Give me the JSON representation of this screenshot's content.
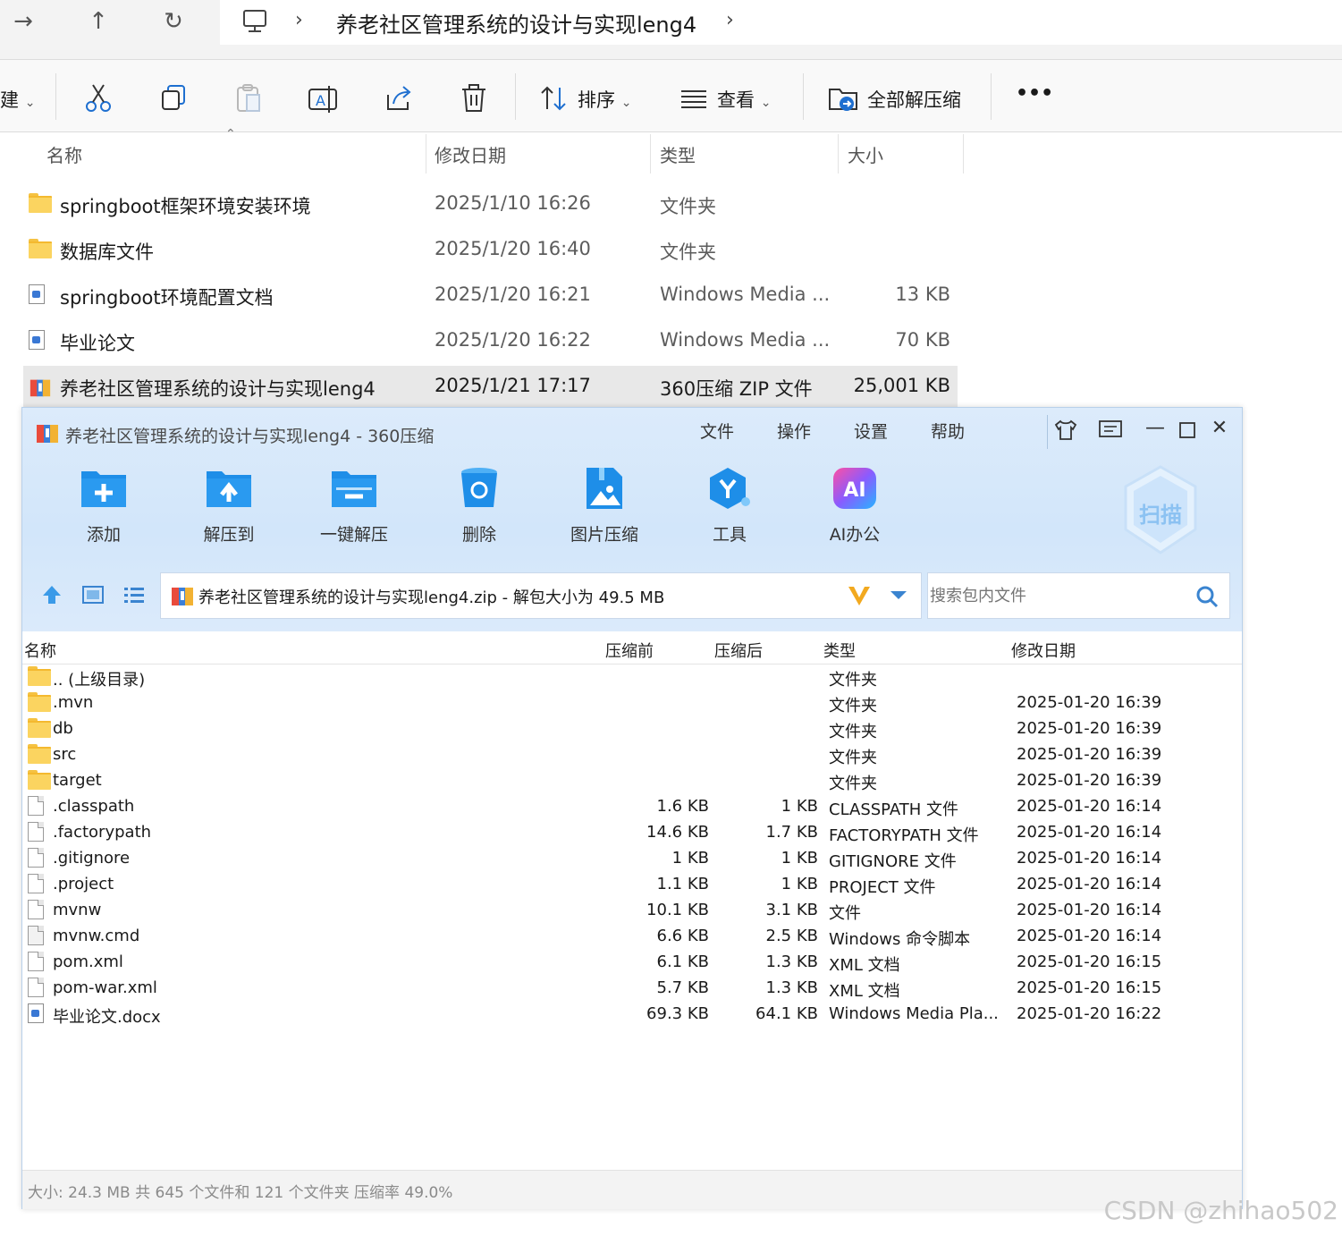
{
  "explorer": {
    "address": {
      "path": "养老社区管理系统的设计与实现leng4"
    },
    "commands": {
      "new_partial": "建",
      "sort": "排序",
      "view": "查看",
      "extract_all": "全部解压缩",
      "more": "•••"
    },
    "columns": {
      "name": "名称",
      "modified": "修改日期",
      "type": "类型",
      "size": "大小"
    },
    "files": [
      {
        "name": "springboot框架环境安装环境",
        "modified": "2025/1/10 16:26",
        "type": "文件夹",
        "size": "",
        "icon": "folder-icon"
      },
      {
        "name": "数据库文件",
        "modified": "2025/1/20 16:40",
        "type": "文件夹",
        "size": "",
        "icon": "folder-icon"
      },
      {
        "name": "springboot环境配置文档",
        "modified": "2025/1/20 16:21",
        "type": "Windows Media ...",
        "size": "13 KB",
        "icon": "media-file-icon"
      },
      {
        "name": "毕业论文",
        "modified": "2025/1/20 16:22",
        "type": "Windows Media ...",
        "size": "70 KB",
        "icon": "media-file-icon"
      },
      {
        "name": "养老社区管理系统的设计与实现leng4",
        "modified": "2025/1/21 17:17",
        "type": "360压缩 ZIP 文件",
        "size": "25,001 KB",
        "icon": "zip-archive-icon"
      }
    ]
  },
  "zip_window": {
    "title": "养老社区管理系统的设计与实现leng4 - 360压缩",
    "menu": [
      "文件",
      "操作",
      "设置",
      "帮助"
    ],
    "toolbar": [
      {
        "label": "添加",
        "icon": "add-icon"
      },
      {
        "label": "解压到",
        "icon": "extract-to-icon"
      },
      {
        "label": "一键解压",
        "icon": "one-click-extract-icon"
      },
      {
        "label": "删除",
        "icon": "delete-icon"
      },
      {
        "label": "图片压缩",
        "icon": "image-compress-icon"
      },
      {
        "label": "工具",
        "icon": "tools-icon"
      },
      {
        "label": "AI办公",
        "icon": "ai-office-icon"
      }
    ],
    "ai_badge": "AI",
    "scan_badge": "扫描",
    "address": "养老社区管理系统的设计与实现leng4.zip - 解包大小为 49.5 MB",
    "search_placeholder": "搜索包内文件",
    "columns": {
      "name": "名称",
      "before": "压缩前",
      "after": "压缩后",
      "type": "类型",
      "modified": "修改日期"
    },
    "files": [
      {
        "name": ".. (上级目录)",
        "before": "",
        "after": "",
        "type": "文件夹",
        "modified": "",
        "icon": "folder-icon"
      },
      {
        "name": ".mvn",
        "before": "",
        "after": "",
        "type": "文件夹",
        "modified": "2025-01-20 16:39",
        "icon": "folder-icon"
      },
      {
        "name": "db",
        "before": "",
        "after": "",
        "type": "文件夹",
        "modified": "2025-01-20 16:39",
        "icon": "folder-icon"
      },
      {
        "name": "src",
        "before": "",
        "after": "",
        "type": "文件夹",
        "modified": "2025-01-20 16:39",
        "icon": "folder-icon"
      },
      {
        "name": "target",
        "before": "",
        "after": "",
        "type": "文件夹",
        "modified": "2025-01-20 16:39",
        "icon": "folder-icon"
      },
      {
        "name": ".classpath",
        "before": "1.6 KB",
        "after": "1 KB",
        "type": "CLASSPATH 文件",
        "modified": "2025-01-20 16:14",
        "icon": "file-icon"
      },
      {
        "name": ".factorypath",
        "before": "14.6 KB",
        "after": "1.7 KB",
        "type": "FACTORYPATH 文件",
        "modified": "2025-01-20 16:14",
        "icon": "file-icon"
      },
      {
        "name": ".gitignore",
        "before": "1 KB",
        "after": "1 KB",
        "type": "GITIGNORE 文件",
        "modified": "2025-01-20 16:14",
        "icon": "file-icon"
      },
      {
        "name": ".project",
        "before": "1.1 KB",
        "after": "1 KB",
        "type": "PROJECT 文件",
        "modified": "2025-01-20 16:14",
        "icon": "file-icon"
      },
      {
        "name": "mvnw",
        "before": "10.1 KB",
        "after": "3.1 KB",
        "type": "文件",
        "modified": "2025-01-20 16:14",
        "icon": "file-icon"
      },
      {
        "name": "mvnw.cmd",
        "before": "6.6 KB",
        "after": "2.5 KB",
        "type": "Windows 命令脚本",
        "modified": "2025-01-20 16:14",
        "icon": "script-file-icon"
      },
      {
        "name": "pom.xml",
        "before": "6.1 KB",
        "after": "1.3 KB",
        "type": "XML 文档",
        "modified": "2025-01-20 16:15",
        "icon": "file-icon"
      },
      {
        "name": "pom-war.xml",
        "before": "5.7 KB",
        "after": "1.3 KB",
        "type": "XML 文档",
        "modified": "2025-01-20 16:15",
        "icon": "file-icon"
      },
      {
        "name": "毕业论文.docx",
        "before": "69.3 KB",
        "after": "64.1 KB",
        "type": "Windows Media Pla...",
        "modified": "2025-01-20 16:22",
        "icon": "media-file-icon"
      }
    ],
    "status": "大小: 24.3 MB 共 645 个文件和 121 个文件夹 压缩率 49.0%"
  },
  "watermark": "CSDN @zhihao502",
  "colors": {
    "zip_header_bg": "#d6e8fb",
    "icon_blue": "#1e8ee8",
    "folder_yellow": "#fbd460",
    "selected_row": "#e8e8e8"
  }
}
